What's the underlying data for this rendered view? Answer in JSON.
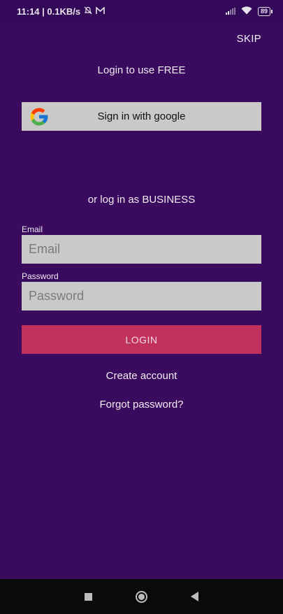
{
  "status_bar": {
    "time_speed": "11:14 | 0.1KB/s",
    "battery": "89",
    "icons": [
      "mute-bell-icon",
      "mail-icon",
      "signal-icon",
      "wifi-icon",
      "battery-icon"
    ]
  },
  "header": {
    "skip_label": "SKIP"
  },
  "free_section": {
    "heading": "Login to use FREE",
    "google_button_label": "Sign in with google"
  },
  "business_section": {
    "heading": "or log in as BUSINESS",
    "email_label": "Email",
    "email_placeholder": "Email",
    "password_label": "Password",
    "password_placeholder": "Password",
    "login_label": "LOGIN",
    "create_account": "Create account",
    "forgot_password": "Forgot password?"
  },
  "colors": {
    "background": "#3a0a5e",
    "login_button": "#c2305e",
    "input_background": "#c9c9c9"
  }
}
